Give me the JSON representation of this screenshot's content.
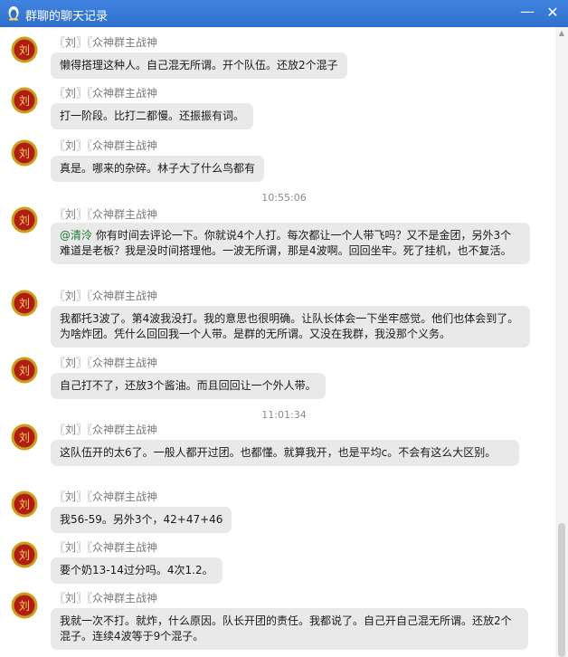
{
  "window": {
    "title": "群聊的聊天记录",
    "minimize_glyph": "—",
    "close_glyph": "✕",
    "app_icon": "penguin-icon"
  },
  "messages": [
    {
      "sender": "〖刘〗〖众神群主战神",
      "text": "懒得搭理这种人。自己混无所谓。开个队伍。还放2个混子"
    },
    {
      "sender": "〖刘〗〖众神群主战神",
      "text": "打一阶段。比打二都慢。还振振有词。"
    },
    {
      "sender": "〖刘〗〖众神群主战神",
      "text": "真是。哪来的杂碎。林子大了什么鸟都有"
    },
    {
      "time": "10:55:06"
    },
    {
      "sender": "〖刘〗〖众神群主战神",
      "mention": "@清泠",
      "text": " 你有时间去评论一下。你就说4个人打。每次都让一个人带飞吗？又不是金团，另外3个难道是老板？我是没时间搭理他。一波无所谓，那是4波啊。回回坐牢。死了挂机，也不复活。"
    },
    {
      "sender": "〖刘〗〖众神群主战神",
      "text": "我都托3波了。第4波我没打。我的意思也很明确。让队长体会一下坐牢感觉。他们也体会到了。为啥炸团。凭什么回回我一个人带。是群的无所谓。又没在我群，我没那个义务。"
    },
    {
      "sender": "〖刘〗〖众神群主战神",
      "text": "自己打不了，还放3个酱油。而且回回让一个外人带。"
    },
    {
      "time": "11:01:34"
    },
    {
      "sender": "〖刘〗〖众神群主战神",
      "text": "这队伍开的太6了。一般人都开过团。也都懂。就算我开，也是平均c。不会有这么大区别。"
    },
    {
      "sender": "〖刘〗〖众神群主战神",
      "text": "我56-59。另外3个，42+47+46"
    },
    {
      "sender": "〖刘〗〖众神群主战神",
      "text": "要个奶13-14过分吗。4次1.2。"
    },
    {
      "sender": "〖刘〗〖众神群主战神",
      "text": "我就一次不打。就炸，什么原因。队长开团的责任。我都说了。自己开自己混无所谓。还放2个混子。连续4波等于9个混子。"
    }
  ],
  "avatar": {
    "glyph": "刘",
    "icon": "avatar-icon"
  },
  "colors": {
    "titlebar": "#2f6fcc",
    "bubble": "#e9e9ea",
    "mention": "#1a7a2c",
    "avatar_ring": "#c8a01e",
    "avatar_red": "#b21d12"
  }
}
